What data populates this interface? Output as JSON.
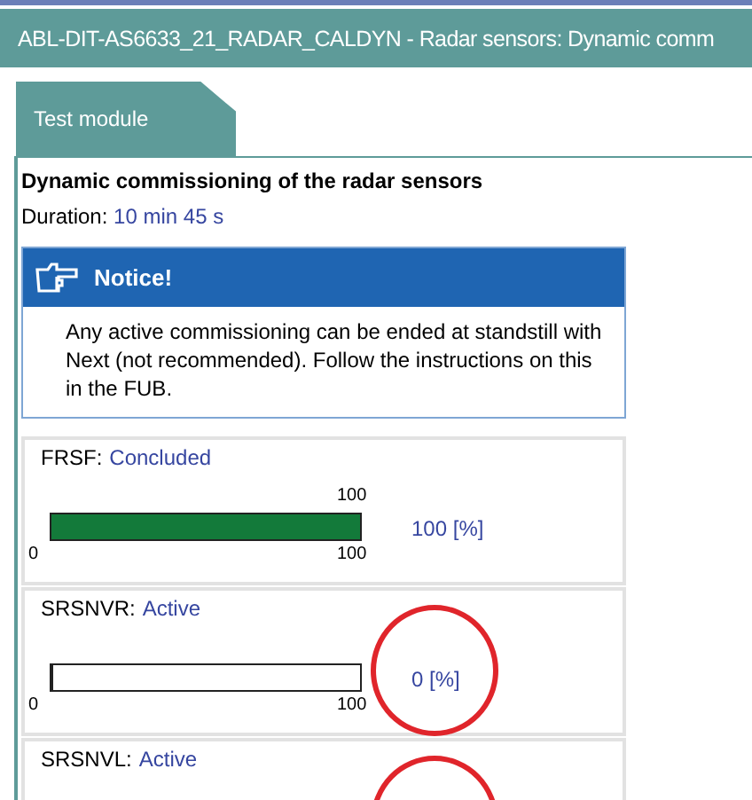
{
  "window": {
    "title": "ABL-DIT-AS6633_21_RADAR_CALDYN - Radar sensors: Dynamic comm"
  },
  "tabs": [
    {
      "label": "Test module",
      "selected": true
    }
  ],
  "heading": "Dynamic commissioning of the radar sensors",
  "duration": {
    "label": "Duration:",
    "value": "10 min 45 s"
  },
  "notice": {
    "title": "Notice!",
    "text": "Any active commissioning can be ended at standstill with Next (not recommended). Follow the instructions on this in the FUB."
  },
  "sensors": [
    {
      "name": "FRSF:",
      "status": "Concluded",
      "level": 1,
      "max_label": "100",
      "min_label": "0",
      "end_label": "100",
      "reading": "100 [%]",
      "highlighted": false
    },
    {
      "name": "SRSNVR:",
      "status": "Active",
      "level": 0,
      "min_label": "0",
      "end_label": "100",
      "reading": "0 [%]",
      "highlighted": true
    },
    {
      "name": "SRSNVL:",
      "status": "Active",
      "highlighted": true
    }
  ]
}
